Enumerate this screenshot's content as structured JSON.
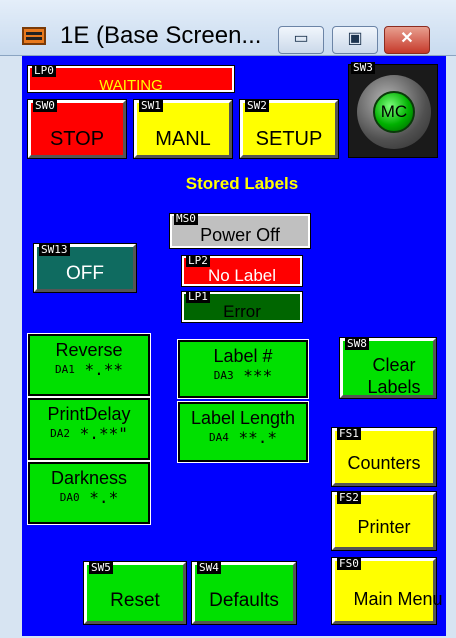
{
  "window": {
    "title": "1E (Base Screen...",
    "minimize_label": "▭",
    "maximize_label": "▣",
    "close_label": "✕"
  },
  "lp0": {
    "tag": "LP0",
    "text": "WAITING"
  },
  "sw0": {
    "tag": "SW0",
    "label": "STOP"
  },
  "sw1": {
    "tag": "SW1",
    "label": "MANL"
  },
  "sw2": {
    "tag": "SW2",
    "label": "SETUP"
  },
  "sw3": {
    "tag": "SW3",
    "label": "MC"
  },
  "heading": "Stored Labels",
  "ms0": {
    "tag": "MS0",
    "text": "Power Off"
  },
  "sw13": {
    "tag": "SW13",
    "label": "OFF"
  },
  "lp2": {
    "tag": "LP2",
    "text": "No Label"
  },
  "lp1": {
    "tag": "LP1",
    "text": "Error"
  },
  "reverse": {
    "label": "Reverse",
    "tag": "DA1",
    "value": "*.**"
  },
  "printdelay": {
    "label": "PrintDelay",
    "tag": "DA2",
    "value": "*.**\""
  },
  "darkness": {
    "label": "Darkness",
    "tag": "DA0",
    "value": "*.*"
  },
  "labelnum": {
    "label": "Label #",
    "tag": "DA3",
    "value": "***"
  },
  "labellength": {
    "label": "Label Length",
    "tag": "DA4",
    "value": "**.*"
  },
  "sw8": {
    "tag": "SW8",
    "label": "Clear Labels"
  },
  "fs1": {
    "tag": "FS1",
    "label": "Counters"
  },
  "fs2": {
    "tag": "FS2",
    "label": "Printer"
  },
  "fs0": {
    "tag": "FS0",
    "label": "Main Menu"
  },
  "sw5": {
    "tag": "SW5",
    "label": "Reset"
  },
  "sw4": {
    "tag": "SW4",
    "label": "Defaults"
  },
  "colors": {
    "background": "#0000ff",
    "green": "#00e000",
    "yellow": "#ffff00",
    "red": "#ff0000",
    "dark_green": "#006600"
  }
}
